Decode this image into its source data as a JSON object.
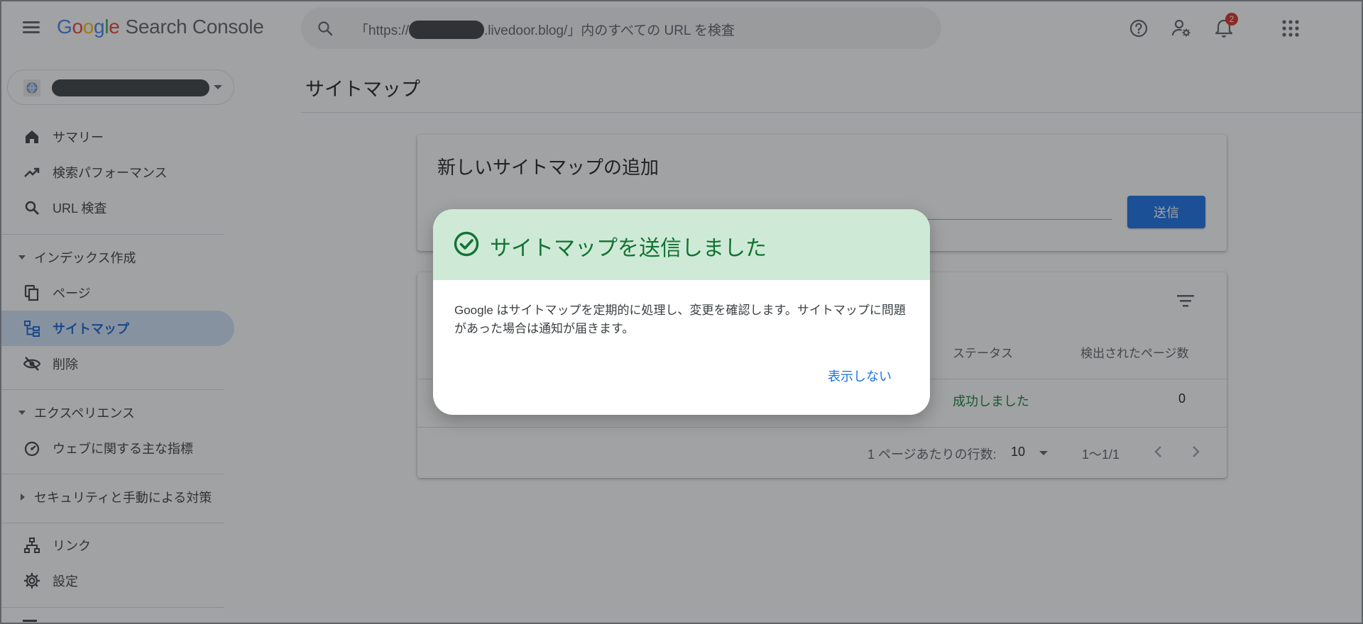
{
  "app": {
    "logo_google": [
      "G",
      "o",
      "o",
      "g",
      "l",
      "e"
    ],
    "product_name": "Search Console"
  },
  "search": {
    "prefix": "「https://",
    "suffix": ".livedoor.blog/」内のすべての URL を検査"
  },
  "topbar": {
    "icons": [
      "help-icon",
      "user-settings-icon",
      "notifications-icon",
      "apps-grid-icon"
    ],
    "notification_count": "2"
  },
  "sidebar": {
    "items": [
      {
        "label": "サマリー",
        "icon": "home-icon"
      },
      {
        "label": "検索パフォーマンス",
        "icon": "trending-up-icon"
      },
      {
        "label": "URL 検査",
        "icon": "search-icon"
      }
    ],
    "section_index": "インデックス作成",
    "index_items": [
      {
        "label": "ページ",
        "icon": "pages-icon"
      },
      {
        "label": "サイトマップ",
        "icon": "sitemap-icon",
        "active": true
      },
      {
        "label": "削除",
        "icon": "visibility-off-icon"
      }
    ],
    "section_experience": "エクスペリエンス",
    "experience_items": [
      {
        "label": "ウェブに関する主な指標",
        "icon": "speed-gauge-icon"
      }
    ],
    "section_security": "セキュリティと手動による対策",
    "bottom_items": [
      {
        "label": "リンク",
        "icon": "links-icon"
      },
      {
        "label": "設定",
        "icon": "settings-gear-icon"
      }
    ]
  },
  "main": {
    "page_title": "サイトマップ",
    "add_card": {
      "title": "新しいサイトマップの追加",
      "submit_label": "送信"
    },
    "table": {
      "headers": {
        "status": "ステータス",
        "discovered_pages": "検出されたページ数"
      },
      "rows": [
        {
          "status": "成功しました",
          "discovered_pages": "0"
        }
      ],
      "rows_per_page_label": "1 ページあたりの行数:",
      "rows_per_page_value": "10",
      "range": "1〜1/1"
    }
  },
  "dialog": {
    "title": "サイトマップを送信しました",
    "body": "Google はサイトマップを定期的に処理し、変更を確認します。サイトマップに問題があった場合は通知が届きます。",
    "dismiss_label": "表示しない"
  },
  "colors": {
    "accent": "#1a73e8",
    "success": "#188038",
    "dialog_header": "#ceead6",
    "active_nav": "#d2e3fc"
  }
}
